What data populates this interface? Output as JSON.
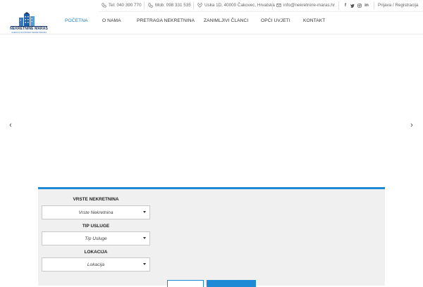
{
  "brand": {
    "name": "NEKRETNINE MARAŠ",
    "tagline": "AGENCIJA ZA PROMET NEKRETNINAMA"
  },
  "topbar": {
    "tel": "Tel: 040 390 770",
    "mob": "Mob: 098 331 535",
    "address": "Uska 1D, 40000 Čakovec, Hrvatska",
    "email": "info@nekretnine-maras.hr",
    "social": [
      "f",
      "t",
      "ig",
      "in"
    ],
    "login": "Prijava / Registracija"
  },
  "nav": {
    "items": [
      "POČETNA",
      "O NAMA",
      "PRETRAGA NEKRETNINA",
      "ZANIMLJIVI ČLANCI",
      "OPĆI UVJETI",
      "KONTAKT"
    ]
  },
  "slider": {
    "prev": "‹",
    "next": "›"
  },
  "search": {
    "fields": [
      {
        "label": "VRSTE NEKRETNINA",
        "value": "Vrste Nekretnina"
      },
      {
        "label": "TIP USLUGE",
        "value": "Tip Usluge"
      },
      {
        "label": "LOKACIJA",
        "value": "Lokacija"
      }
    ]
  },
  "colors": {
    "accent": "#1e8ad6",
    "nav_text": "#333333",
    "panel_bg": "#f0f0f0",
    "logo_dark": "#1b3a6b"
  }
}
